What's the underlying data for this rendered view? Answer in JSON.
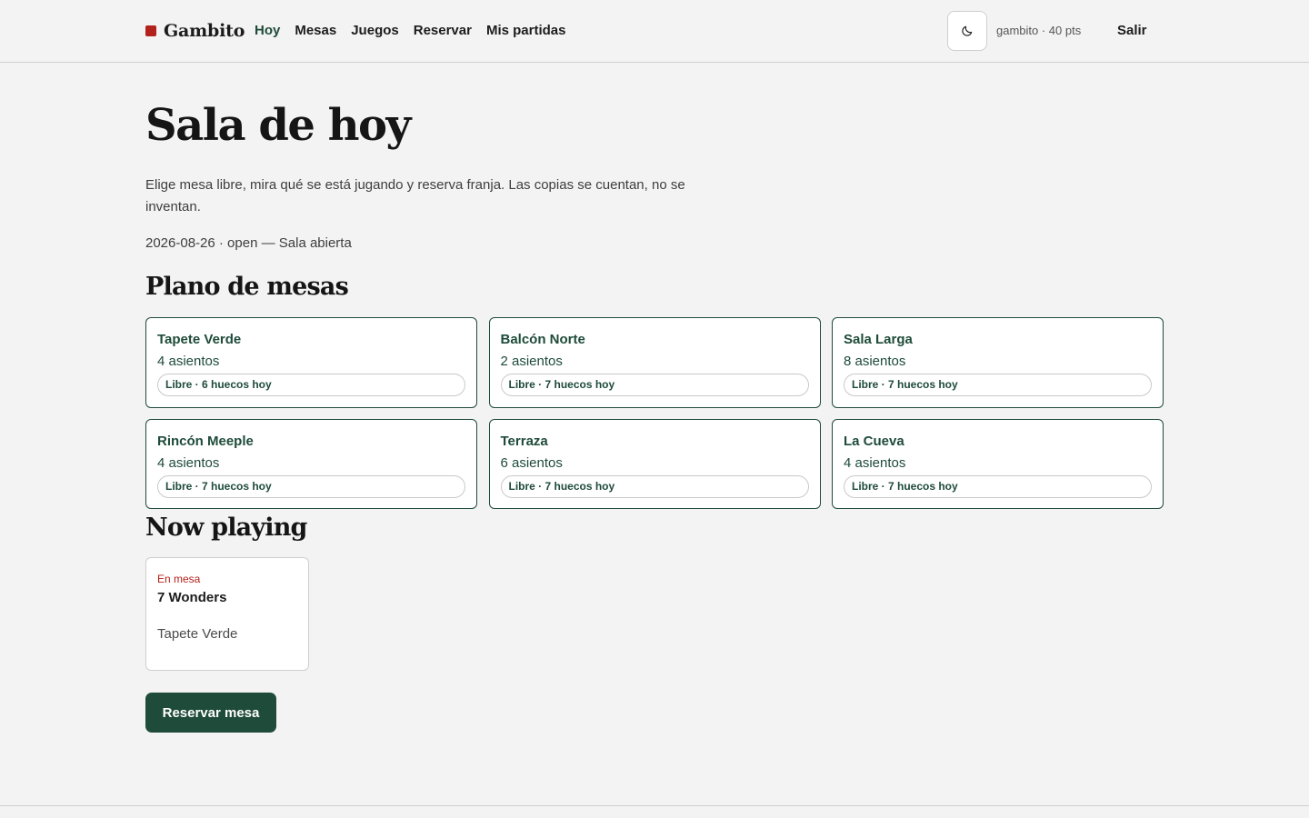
{
  "header": {
    "brand": "Gambito",
    "nav": [
      {
        "label": "Hoy",
        "active": true
      },
      {
        "label": "Mesas",
        "active": false
      },
      {
        "label": "Juegos",
        "active": false
      },
      {
        "label": "Reservar",
        "active": false
      },
      {
        "label": "Mis partidas",
        "active": false
      }
    ],
    "theme_icon": "moon-icon",
    "user_info": "gambito · 40 pts",
    "logout": "Salir"
  },
  "main": {
    "title": "Sala de hoy",
    "intro": "Elige mesa libre, mira qué se está jugando y reserva franja. Las copias se cuentan, no se inventan.",
    "status_line": "2026-08-26 · open — Sala abierta",
    "tables_heading": "Plano de mesas",
    "tables": [
      {
        "name": "Tapete Verde",
        "seats": "4 asientos",
        "status": "Libre · 6 huecos hoy"
      },
      {
        "name": "Balcón Norte",
        "seats": "2 asientos",
        "status": "Libre · 7 huecos hoy"
      },
      {
        "name": "Sala Larga",
        "seats": "8 asientos",
        "status": "Libre · 7 huecos hoy"
      },
      {
        "name": "Rincón Meeple",
        "seats": "4 asientos",
        "status": "Libre · 7 huecos hoy"
      },
      {
        "name": "Terraza",
        "seats": "6 asientos",
        "status": "Libre · 7 huecos hoy"
      },
      {
        "name": "La Cueva",
        "seats": "4 asientos",
        "status": "Libre · 7 huecos hoy"
      }
    ],
    "now_heading": "Now playing",
    "now_playing": [
      {
        "badge": "En mesa",
        "game": "7 Wonders",
        "table": "Tapete Verde"
      }
    ],
    "cta": "Reservar mesa"
  },
  "colors": {
    "accent_green": "#1e4b3a",
    "brand_red": "#b3211c",
    "background": "#f3f3f3"
  }
}
